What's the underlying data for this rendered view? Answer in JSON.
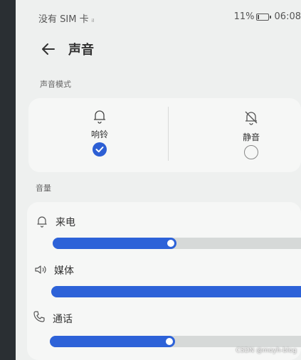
{
  "statusbar": {
    "carrier": "没有 SIM 卡",
    "signal_glyph": "ᵢₗ",
    "battery_text": "11%",
    "battery_level": 0.11,
    "time": "06:08"
  },
  "header": {
    "title": "声音"
  },
  "sound_mode": {
    "section_label": "声音模式",
    "modes": [
      {
        "label": "响铃",
        "selected": true,
        "icon": "bell-icon"
      },
      {
        "label": "静音",
        "selected": false,
        "icon": "bell-muted-icon"
      }
    ]
  },
  "volume": {
    "section_label": "音量",
    "rows": [
      {
        "label": "来电",
        "icon": "bell-icon",
        "level": 0.48
      },
      {
        "label": "媒体",
        "icon": "speaker-icon",
        "level": 1.0
      },
      {
        "label": "通话",
        "icon": "phone-icon",
        "level": 0.48
      }
    ]
  },
  "watermark": "CSDN @moyh-blog",
  "colors": {
    "accent": "#2d62d8",
    "track": "#d6d9d8",
    "background": "#eef0ef"
  }
}
